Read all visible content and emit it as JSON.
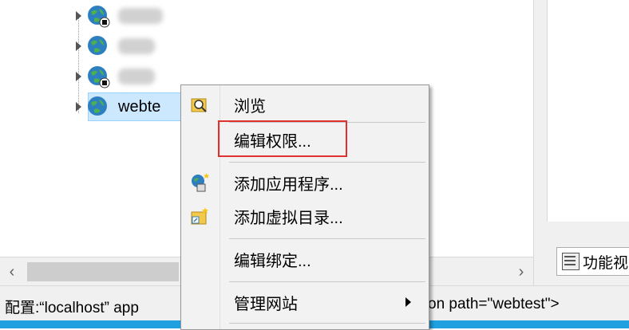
{
  "tree": {
    "selected_label": "webte"
  },
  "context_menu": {
    "items": [
      {
        "label": "浏览",
        "icon": "browse-folder-icon"
      },
      {
        "label": "编辑权限...",
        "icon": ""
      },
      {
        "label": "添加应用程序...",
        "icon": "add-application-icon"
      },
      {
        "label": "添加虚拟目录...",
        "icon": "add-virtual-directory-icon"
      },
      {
        "label": "编辑绑定...",
        "icon": ""
      },
      {
        "label": "管理网站",
        "icon": "",
        "has_submenu": true
      }
    ]
  },
  "right_pane": {
    "feature_tab_label": "功能视"
  },
  "status_bar": {
    "left_text": "配置:“localhost” app",
    "right_text": "on path=\"webtest\">"
  },
  "colors": {
    "highlight_border": "#e03030",
    "selection_bg": "#cce8ff",
    "taskbar_strip": "#1fa0e0"
  }
}
